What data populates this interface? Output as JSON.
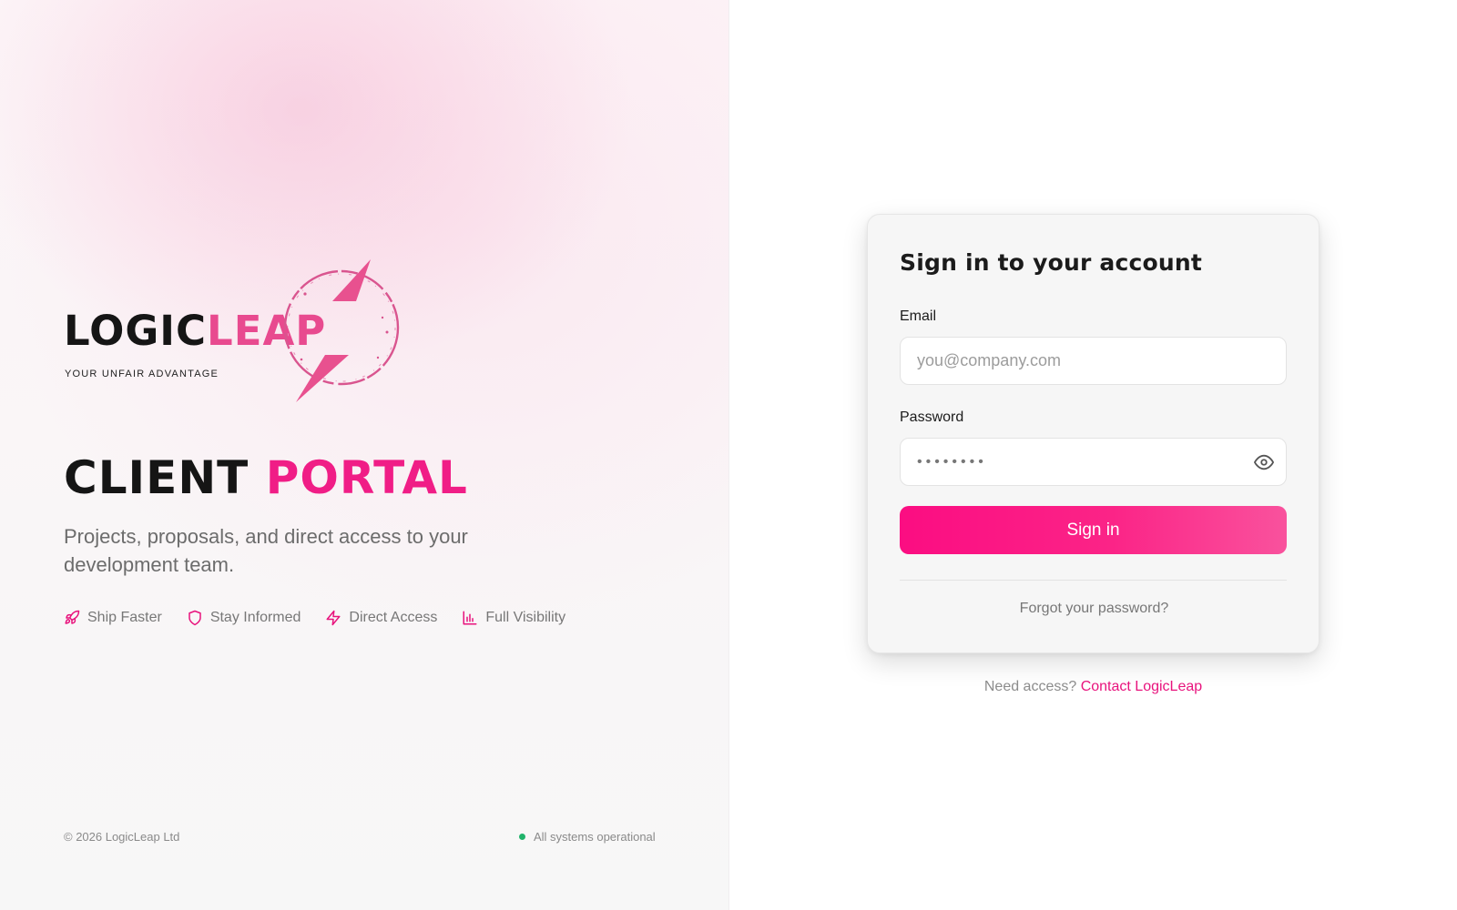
{
  "brand": {
    "logo_dark": "LOGIC",
    "logo_pink": "LEAP",
    "tagline": "YOUR UNFAIR ADVANTAGE",
    "mark_icon": "lightning-ring-icon",
    "colors": {
      "primary_pink": "#f01d86",
      "logo_pink": "#e84a8f",
      "dark": "#151515"
    }
  },
  "hero": {
    "title_dark": "CLIENT",
    "title_pink": "PORTAL",
    "subtitle": "Projects, proposals, and direct access to your development team."
  },
  "features": [
    {
      "label": "Ship Faster",
      "icon": "rocket-icon"
    },
    {
      "label": "Stay Informed",
      "icon": "shield-icon"
    },
    {
      "label": "Direct Access",
      "icon": "lightning-icon"
    },
    {
      "label": "Full Visibility",
      "icon": "bar-chart-icon"
    }
  ],
  "footer": {
    "copyright": "© 2026 LogicLeap Ltd",
    "status": "All systems operational",
    "status_color": "#20b36a"
  },
  "login": {
    "title": "Sign in to your account",
    "email_label": "Email",
    "email_placeholder": "you@company.com",
    "email_value": "",
    "password_label": "Password",
    "password_value": "••••••••",
    "show_password_icon": "eye-icon",
    "submit_label": "Sign in",
    "forgot_label": "Forgot your password?",
    "need_access_text": "Need access?",
    "contact_label": "Contact LogicLeap"
  }
}
